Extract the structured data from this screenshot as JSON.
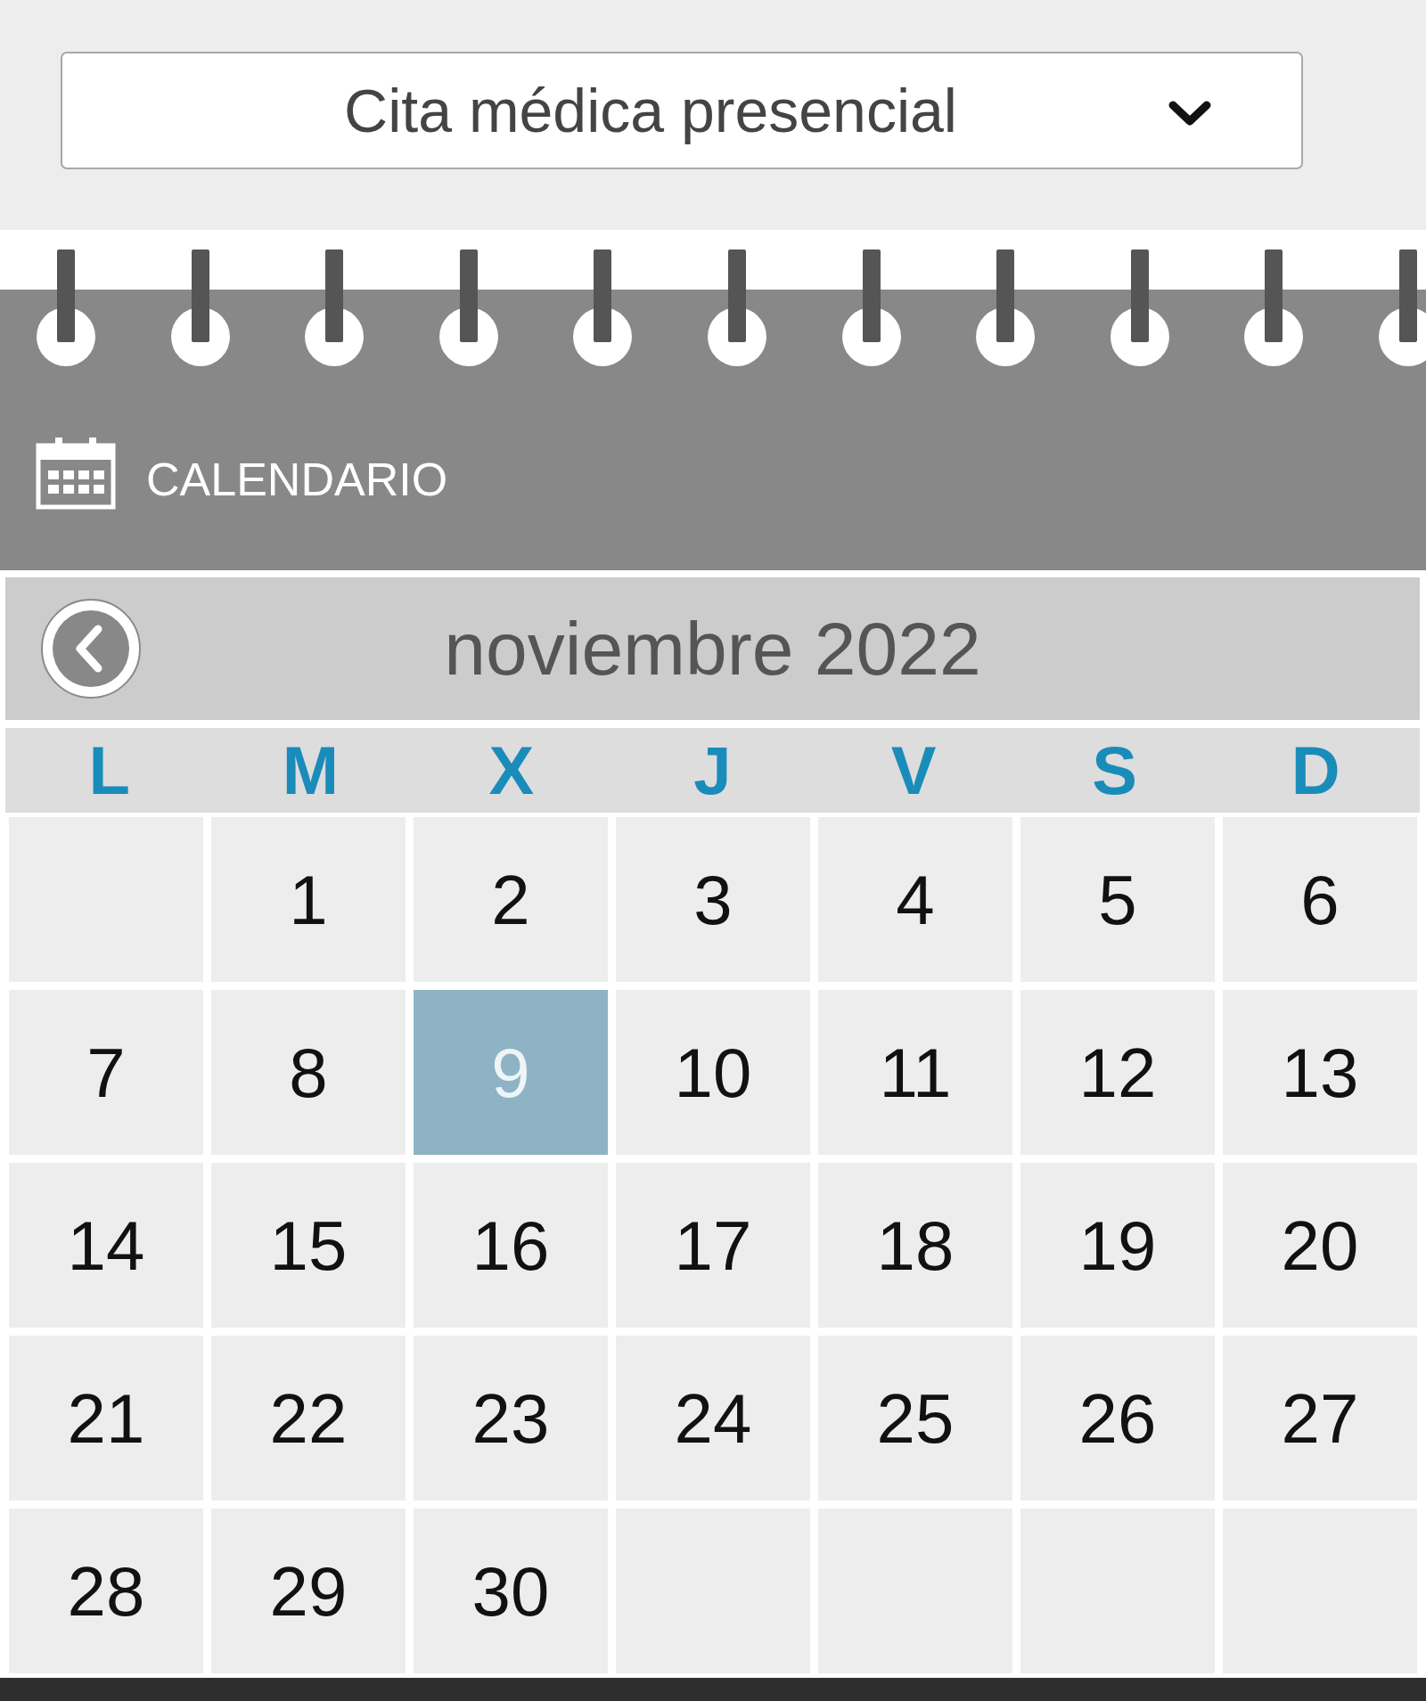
{
  "appointment_type": {
    "value": "Cita médica presencial"
  },
  "calendar": {
    "title": "CALENDARIO",
    "month": "noviembre 2022",
    "weekdays": [
      "L",
      "M",
      "X",
      "J",
      "V",
      "S",
      "D"
    ],
    "weeks": [
      [
        {
          "kind": "blank"
        },
        {
          "kind": "day",
          "label": "1",
          "selected": false
        },
        {
          "kind": "day",
          "label": "2",
          "selected": false
        },
        {
          "kind": "day",
          "label": "3",
          "selected": false
        },
        {
          "kind": "day",
          "label": "4",
          "selected": false
        },
        {
          "kind": "day",
          "label": "5",
          "selected": false
        },
        {
          "kind": "day",
          "label": "6",
          "selected": false
        }
      ],
      [
        {
          "kind": "day",
          "label": "7",
          "selected": false
        },
        {
          "kind": "day",
          "label": "8",
          "selected": false
        },
        {
          "kind": "day",
          "label": "9",
          "selected": true
        },
        {
          "kind": "day",
          "label": "10",
          "selected": false
        },
        {
          "kind": "day",
          "label": "11",
          "selected": false
        },
        {
          "kind": "day",
          "label": "12",
          "selected": false
        },
        {
          "kind": "day",
          "label": "13",
          "selected": false
        }
      ],
      [
        {
          "kind": "day",
          "label": "14",
          "selected": false
        },
        {
          "kind": "day",
          "label": "15",
          "selected": false
        },
        {
          "kind": "day",
          "label": "16",
          "selected": false
        },
        {
          "kind": "day",
          "label": "17",
          "selected": false
        },
        {
          "kind": "day",
          "label": "18",
          "selected": false
        },
        {
          "kind": "day",
          "label": "19",
          "selected": false
        },
        {
          "kind": "day",
          "label": "20",
          "selected": false
        }
      ],
      [
        {
          "kind": "day",
          "label": "21",
          "selected": false
        },
        {
          "kind": "day",
          "label": "22",
          "selected": false
        },
        {
          "kind": "day",
          "label": "23",
          "selected": false
        },
        {
          "kind": "day",
          "label": "24",
          "selected": false
        },
        {
          "kind": "day",
          "label": "25",
          "selected": false
        },
        {
          "kind": "day",
          "label": "26",
          "selected": false
        },
        {
          "kind": "day",
          "label": "27",
          "selected": false
        }
      ],
      [
        {
          "kind": "day",
          "label": "28",
          "selected": false
        },
        {
          "kind": "day",
          "label": "29",
          "selected": false
        },
        {
          "kind": "day",
          "label": "30",
          "selected": false
        },
        {
          "kind": "blank"
        },
        {
          "kind": "blank"
        },
        {
          "kind": "blank"
        },
        {
          "kind": "blank"
        }
      ]
    ]
  }
}
